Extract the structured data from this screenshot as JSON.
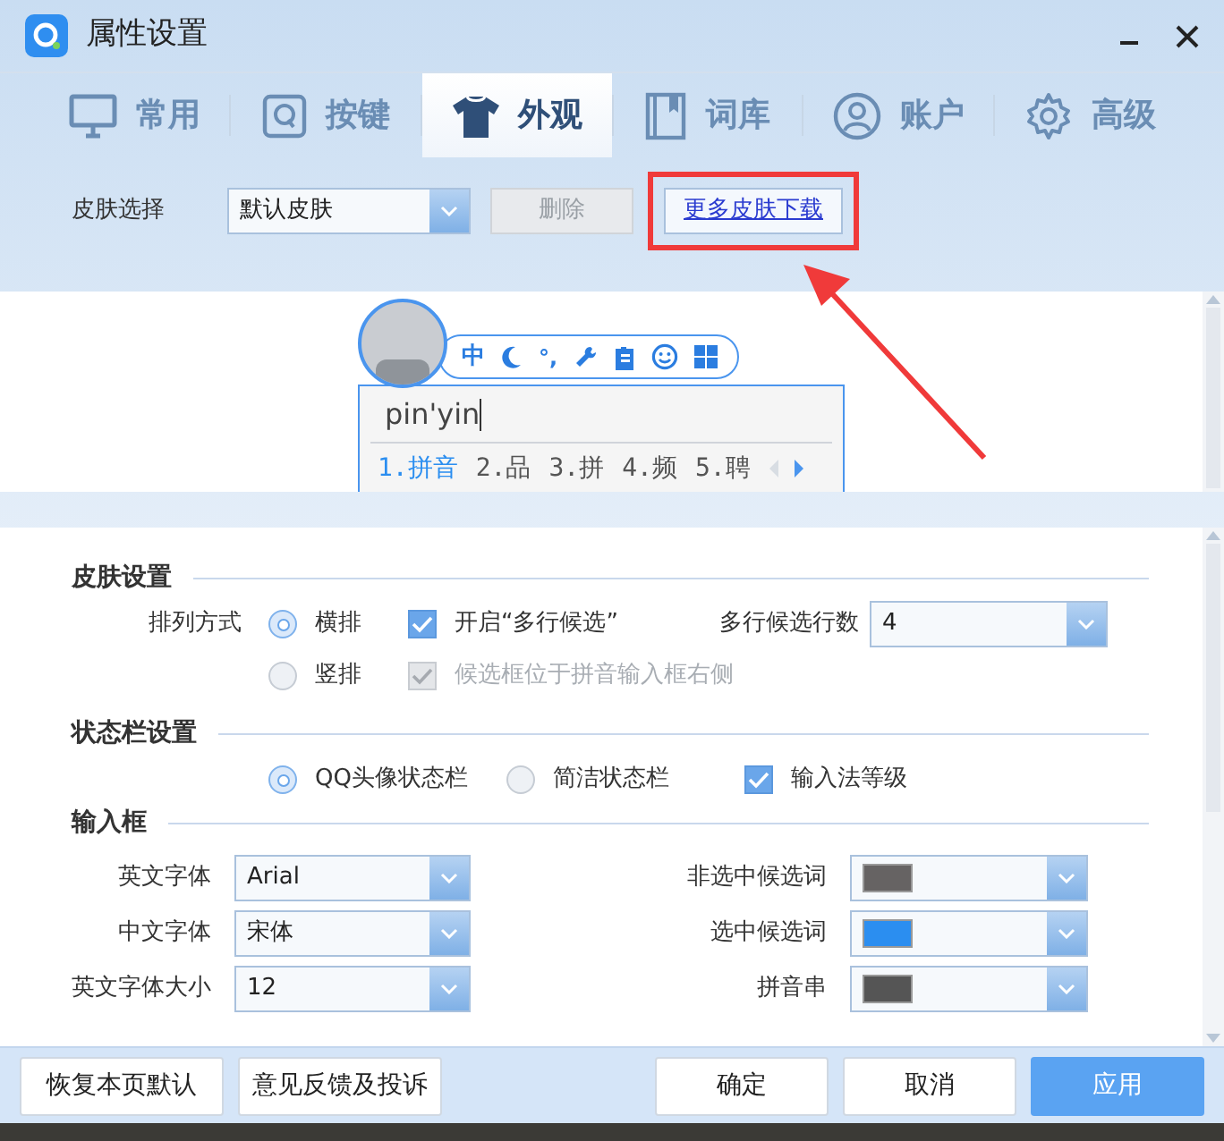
{
  "window": {
    "title": "属性设置"
  },
  "tabs": [
    {
      "label": "常用",
      "selected": false
    },
    {
      "label": "按键",
      "selected": false
    },
    {
      "label": "外观",
      "selected": true
    },
    {
      "label": "词库",
      "selected": false
    },
    {
      "label": "账户",
      "selected": false
    },
    {
      "label": "高级",
      "selected": false
    }
  ],
  "skin_selector": {
    "label": "皮肤选择",
    "value": "默认皮肤",
    "delete_button": {
      "label": "删除",
      "disabled": true
    },
    "download_link": {
      "label": "更多皮肤下载",
      "highlighted": true
    }
  },
  "preview": {
    "mode": "中",
    "punctuation": "°,",
    "input": "pin'yin",
    "candidates": [
      {
        "label": "1.拼音",
        "selected": true
      },
      {
        "label": "2.品",
        "selected": false
      },
      {
        "label": "3.拼",
        "selected": false
      },
      {
        "label": "4.频",
        "selected": false
      },
      {
        "label": "5.聘",
        "selected": false
      }
    ]
  },
  "skin_settings": {
    "title": "皮肤设置",
    "layout_label": "排列方式",
    "layout_options": [
      {
        "label": "横排",
        "selected": true
      },
      {
        "label": "竖排",
        "selected": false
      }
    ],
    "multiline": {
      "label": "开启“多行候选”",
      "checked": true
    },
    "right_of_input": {
      "label": "候选框位于拼音输入框右侧",
      "checked": true,
      "disabled": true
    },
    "rows_label": "多行候选行数",
    "rows_value": "4"
  },
  "status_bar_settings": {
    "title": "状态栏设置",
    "options": [
      {
        "label": "QQ头像状态栏",
        "selected": true
      },
      {
        "label": "简洁状态栏",
        "selected": false
      }
    ],
    "level": {
      "label": "输入法等级",
      "checked": true
    }
  },
  "input_box": {
    "title": "输入框",
    "rows": [
      {
        "font_label": "英文字体",
        "font_value": "Arial",
        "color_label": "非选中候选词",
        "color": "#666363"
      },
      {
        "font_label": "中文字体",
        "font_value": "宋体",
        "color_label": "选中候选词",
        "color": "#2b8ef0"
      },
      {
        "font_label": "英文字体大小",
        "font_value": "12",
        "color_label": "拼音串",
        "color": "#555555"
      }
    ]
  },
  "footer_buttons": [
    {
      "label": "恢复本页默认",
      "kind": "default"
    },
    {
      "label": "意见反馈及投诉",
      "kind": "default"
    },
    {
      "label": "确定",
      "kind": "default"
    },
    {
      "label": "取消",
      "kind": "default"
    },
    {
      "label": "应用",
      "kind": "primary"
    }
  ]
}
